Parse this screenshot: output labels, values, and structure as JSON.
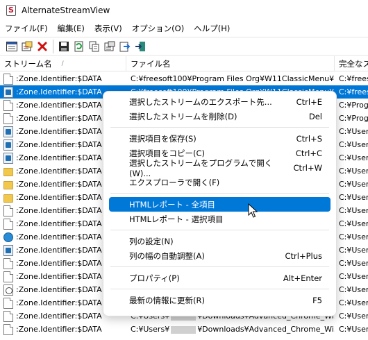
{
  "window": {
    "title": "AlternateStreamView"
  },
  "menu": [
    "ファイル(F)",
    "編集(E)",
    "表示(V)",
    "オプション(O)",
    "ヘルプ(H)"
  ],
  "toolbar": {
    "icons": [
      "html-report-icon",
      "properties-icon",
      "delete-icon",
      "save-icon",
      "refresh-icon",
      "copy-icon",
      "options-icon",
      "export-icon",
      "exit-icon"
    ]
  },
  "columns": {
    "stream_name": "ストリーム名",
    "sort_arrow": "/",
    "file_name": "ファイル名",
    "full_name": "完全なス"
  },
  "rows": [
    {
      "icon": "doc",
      "stream": ":Zone.Identifier:$DATA",
      "file": "C:¥freesoft100¥Program Files Org¥W11ClassicMenu¥...",
      "full": "C:¥freesc",
      "selected": false
    },
    {
      "icon": "img",
      "stream": ":Zone.Identifier:$DATA",
      "file": "C:¥freesoft100¥Program Files Org¥W11ClassicMenu¥...",
      "full": "C:¥frees",
      "selected": true
    },
    {
      "icon": "doc",
      "stream": ":Zone.Identifier:$DATA",
      "file": "",
      "full": "C:¥Progr",
      "selected": false
    },
    {
      "icon": "doc",
      "stream": ":Zone.Identifier:$DATA",
      "file": "",
      "full": "C:¥Progr",
      "selected": false
    },
    {
      "icon": "img",
      "stream": ":Zone.Identifier:$DATA",
      "file": "",
      "full": "C:¥Users",
      "selected": false
    },
    {
      "icon": "img",
      "stream": ":Zone.Identifier:$DATA",
      "file": "",
      "full": "C:¥Users",
      "selected": false
    },
    {
      "icon": "img",
      "stream": ":Zone.Identifier:$DATA",
      "file": "",
      "full": "C:¥Users",
      "selected": false
    },
    {
      "icon": "folder",
      "stream": ":Zone.Identifier:$DATA",
      "file": "",
      "full": "C:¥Users",
      "selected": false
    },
    {
      "icon": "folder",
      "stream": ":Zone.Identifier:$DATA",
      "file": "",
      "full": "C:¥Users",
      "selected": false
    },
    {
      "icon": "folder",
      "stream": ":Zone.Identifier:$DATA",
      "file": "",
      "full": "C:¥Users",
      "selected": false
    },
    {
      "icon": "doc",
      "stream": ":Zone.Identifier:$DATA",
      "file": "",
      "full": "C:¥Users",
      "selected": false
    },
    {
      "icon": "doc",
      "stream": ":Zone.Identifier:$DATA",
      "file": "",
      "full": "C:¥Users",
      "selected": false
    },
    {
      "icon": "globe",
      "stream": ":Zone.Identifier:$DATA",
      "file": "",
      "full": "C:¥Users",
      "selected": false
    },
    {
      "icon": "img",
      "stream": ":Zone.Identifier:$DATA",
      "file": "",
      "full": "C:¥Users",
      "selected": false
    },
    {
      "icon": "doc",
      "stream": ":Zone.Identifier:$DATA",
      "file": "",
      "full": "C:¥Users",
      "selected": false
    },
    {
      "icon": "doc",
      "stream": ":Zone.Identifier:$DATA",
      "file": "",
      "full": "C:¥Users",
      "selected": false
    },
    {
      "icon": "exe",
      "stream": ":Zone.Identifier:$DATA",
      "file": "",
      "full": "C:¥Users",
      "selected": false
    },
    {
      "icon": "doc",
      "stream": ":Zone.Identifier:$DATA",
      "file": "",
      "full": "C:¥Users",
      "selected": false
    },
    {
      "icon": "doc",
      "stream": ":Zone.Identifier:$DATA",
      "file_pre": "C:¥Users¥",
      "file_post": "¥Downloads¥Advanced_Chrome_Wi...",
      "full": "C:¥Users",
      "selected": false,
      "redacted": true
    },
    {
      "icon": "doc",
      "stream": ":Zone.Identifier:$DATA",
      "file_pre": "C:¥Users¥",
      "file_post": "¥Downloads¥Advanced_Chrome_Wi...",
      "full": "C:¥Users",
      "selected": false,
      "redacted": true
    }
  ],
  "context_menu": {
    "items": [
      {
        "label": "選択したストリームのエクスポート先...",
        "shortcut": "Ctrl+E"
      },
      {
        "label": "選択したストリームを削除(D)",
        "shortcut": "Del"
      },
      {
        "sep": true
      },
      {
        "label": "選択項目を保存(S)",
        "shortcut": "Ctrl+S"
      },
      {
        "label": "選択項目をコピー(C)",
        "shortcut": "Ctrl+C"
      },
      {
        "label": "選択したストリームをプログラムで開く(W)...",
        "shortcut": "Ctrl+W"
      },
      {
        "label": "エクスプローラで開く(F)",
        "shortcut": ""
      },
      {
        "sep": true
      },
      {
        "label": "HTMLレポート - 全項目",
        "shortcut": "",
        "highlighted": true
      },
      {
        "label": "HTMLレポート - 選択項目",
        "shortcut": ""
      },
      {
        "sep": true
      },
      {
        "label": "列の設定(N)",
        "shortcut": ""
      },
      {
        "label": "列の幅の自動調整(A)",
        "shortcut": "Ctrl+Plus"
      },
      {
        "sep": true
      },
      {
        "label": "プロパティ(P)",
        "shortcut": "Alt+Enter"
      },
      {
        "sep": true
      },
      {
        "label": "最新の情報に更新(R)",
        "shortcut": "F5"
      }
    ]
  },
  "colors": {
    "selection": "#0078d7"
  }
}
